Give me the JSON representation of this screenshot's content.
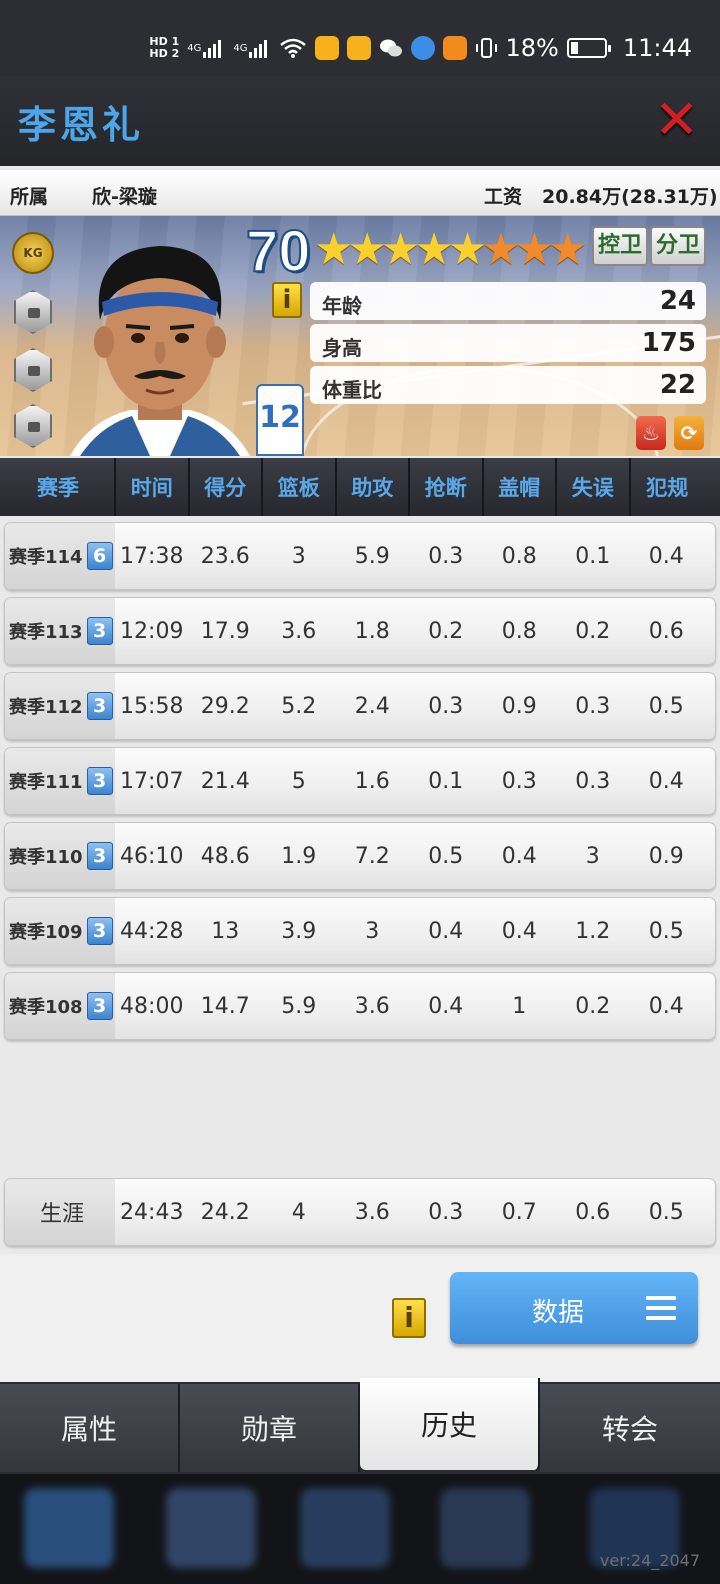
{
  "status_bar": {
    "hd1": "HD 1",
    "hd2": "HD 2",
    "net1": "4G",
    "net2": "4G",
    "battery": "18%",
    "time": "11:44"
  },
  "header": {
    "title": "李恩礼",
    "close_icon": "close-icon"
  },
  "info_strip": {
    "team_label": "所属",
    "team_value": "欣-梁璇",
    "salary_label": "工资",
    "salary_value": "20.84万(28.31万)"
  },
  "player": {
    "rating": "70",
    "stars_gold": 5,
    "stars_orange": 3,
    "badge": "KG",
    "jersey_number": "12",
    "positions": [
      "控卫",
      "分卫"
    ],
    "attributes": [
      {
        "label": "年龄",
        "value": "24"
      },
      {
        "label": "身高",
        "value": "175"
      },
      {
        "label": "体重比",
        "value": "22"
      }
    ],
    "info_icon": "i"
  },
  "table": {
    "headers": [
      "赛季",
      "时间",
      "得分",
      "篮板",
      "助攻",
      "抢断",
      "盖帽",
      "失误",
      "犯规"
    ],
    "rows": [
      {
        "season": "赛季114",
        "level": "6",
        "values": [
          "17:38",
          "23.6",
          "3",
          "5.9",
          "0.3",
          "0.8",
          "0.1",
          "0.4"
        ]
      },
      {
        "season": "赛季113",
        "level": "3",
        "values": [
          "12:09",
          "17.9",
          "3.6",
          "1.8",
          "0.2",
          "0.8",
          "0.2",
          "0.6"
        ]
      },
      {
        "season": "赛季112",
        "level": "3",
        "values": [
          "15:58",
          "29.2",
          "5.2",
          "2.4",
          "0.3",
          "0.9",
          "0.3",
          "0.5"
        ]
      },
      {
        "season": "赛季111",
        "level": "3",
        "values": [
          "17:07",
          "21.4",
          "5",
          "1.6",
          "0.1",
          "0.3",
          "0.3",
          "0.4"
        ]
      },
      {
        "season": "赛季110",
        "level": "3",
        "values": [
          "46:10",
          "48.6",
          "1.9",
          "7.2",
          "0.5",
          "0.4",
          "3",
          "0.9"
        ]
      },
      {
        "season": "赛季109",
        "level": "3",
        "values": [
          "44:28",
          "13",
          "3.9",
          "3",
          "0.4",
          "0.4",
          "1.2",
          "0.5"
        ]
      },
      {
        "season": "赛季108",
        "level": "3",
        "values": [
          "48:00",
          "14.7",
          "5.9",
          "3.6",
          "0.4",
          "1",
          "0.2",
          "0.4"
        ]
      }
    ],
    "career": {
      "label": "生涯",
      "values": [
        "24:43",
        "24.2",
        "4",
        "3.6",
        "0.3",
        "0.7",
        "0.6",
        "0.5"
      ]
    }
  },
  "actions": {
    "info_icon": "i",
    "data_button": "数据"
  },
  "tabs": [
    {
      "label": "属性",
      "active": false
    },
    {
      "label": "勋章",
      "active": false
    },
    {
      "label": "历史",
      "active": true
    },
    {
      "label": "转会",
      "active": false
    }
  ],
  "version": "ver:24_2047",
  "colors": {
    "accent": "#4ea6ea",
    "close": "#d21f23",
    "button": "#4a97e0",
    "level_badge": "#3b84d0"
  }
}
